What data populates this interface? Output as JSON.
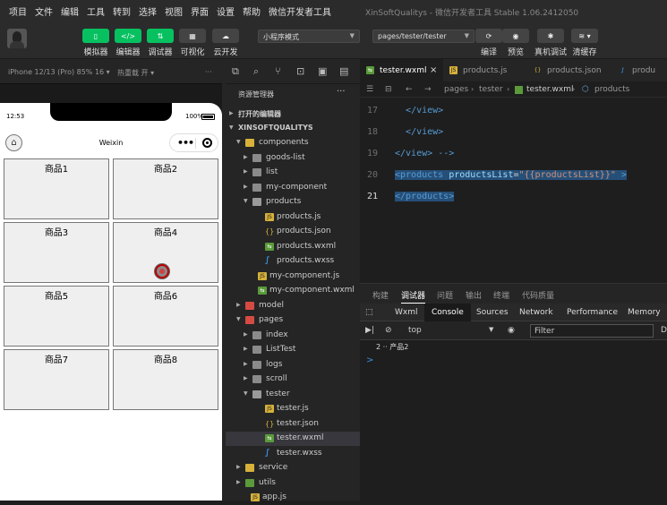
{
  "menubar": {
    "items": [
      "项目",
      "文件",
      "编辑",
      "工具",
      "转到",
      "选择",
      "视图",
      "界面",
      "设置",
      "帮助",
      "微信开发者工具"
    ],
    "title": "XinSoftQualitys - 微信开发者工具 Stable 1.06.2412050"
  },
  "toolbar": {
    "simulator": "模拟器",
    "editor": "编辑器",
    "debugger": "调试器",
    "visual": "可视化",
    "cloud": "云开发",
    "mode_select": "小程序模式",
    "page_select": "pages/tester/tester",
    "compile": "编译",
    "preview": "预览",
    "remote_debug": "真机调试",
    "clear_cache": "清缓存"
  },
  "simulator": {
    "device": "iPhone 12/13 (Pro) 85% 16 ▾",
    "hot_reload": "热重载 开 ▾",
    "more": "···",
    "time": "12:53",
    "battery": "100%",
    "nav_title": "Weixin",
    "capsule_dots": "•••",
    "products": [
      "商品1",
      "商品2",
      "商品3",
      "商品4",
      "商品5",
      "商品6",
      "商品7",
      "商品8"
    ]
  },
  "explorer": {
    "title": "资源管理器",
    "more": "···",
    "open_editors": "打开的编辑器",
    "project": "XINSOFTQUALITYS",
    "tree": [
      {
        "label": "components",
        "depth": 1,
        "type": "comp",
        "open": true
      },
      {
        "label": "goods-list",
        "depth": 2,
        "type": "folder",
        "open": false
      },
      {
        "label": "list",
        "depth": 2,
        "type": "folder",
        "open": false
      },
      {
        "label": "my-component",
        "depth": 2,
        "type": "folder",
        "open": false
      },
      {
        "label": "products",
        "depth": 2,
        "type": "open",
        "open": true
      },
      {
        "label": "products.js",
        "depth": 3,
        "type": "js"
      },
      {
        "label": "products.json",
        "depth": 3,
        "type": "json"
      },
      {
        "label": "products.wxml",
        "depth": 3,
        "type": "wxml"
      },
      {
        "label": "products.wxss",
        "depth": 3,
        "type": "wxss"
      },
      {
        "label": "my-component.js",
        "depth": 2,
        "type": "js"
      },
      {
        "label": "my-component.wxml",
        "depth": 2,
        "type": "wxml"
      },
      {
        "label": "model",
        "depth": 1,
        "type": "model",
        "open": false
      },
      {
        "label": "pages",
        "depth": 1,
        "type": "pages",
        "open": true
      },
      {
        "label": "index",
        "depth": 2,
        "type": "folder",
        "open": false
      },
      {
        "label": "ListTest",
        "depth": 2,
        "type": "folder",
        "open": false
      },
      {
        "label": "logs",
        "depth": 2,
        "type": "folder",
        "open": false
      },
      {
        "label": "scroll",
        "depth": 2,
        "type": "folder",
        "open": false
      },
      {
        "label": "tester",
        "depth": 2,
        "type": "open",
        "open": true
      },
      {
        "label": "tester.js",
        "depth": 3,
        "type": "js"
      },
      {
        "label": "tester.json",
        "depth": 3,
        "type": "json"
      },
      {
        "label": "tester.wxml",
        "depth": 3,
        "type": "wxml",
        "selected": true
      },
      {
        "label": "tester.wxss",
        "depth": 3,
        "type": "wxss"
      },
      {
        "label": "service",
        "depth": 1,
        "type": "serv",
        "open": false
      },
      {
        "label": "utils",
        "depth": 1,
        "type": "utils",
        "open": false
      },
      {
        "label": "app.js",
        "depth": 1,
        "type": "js"
      }
    ]
  },
  "editor": {
    "tabs": [
      {
        "label": "tester.wxml",
        "type": "wxml",
        "active": true
      },
      {
        "label": "products.js",
        "type": "js"
      },
      {
        "label": "products.json",
        "type": "json"
      },
      {
        "label": "produ",
        "type": "wxss"
      }
    ],
    "breadcrumb": [
      "pages",
      "tester",
      "tester.wxml",
      "products"
    ],
    "lines": [
      {
        "num": "17",
        "html": "<span class=\"tag\">&lt;/view&gt;</span>",
        "indent": "  "
      },
      {
        "num": "18",
        "html": "<span class=\"tag\">&lt;/view&gt;</span>",
        "indent": "  "
      },
      {
        "num": "19",
        "html": "<span class=\"tag\">&lt;/view&gt;</span> <span class=\"tag\">--&gt;</span>",
        "indent": ""
      },
      {
        "num": "20",
        "html": "<span class=\"hl\"><span class=\"tag\">&lt;products</span> <span class=\"attr\">productsList</span>=<span class=\"str\">\"{{productsList}}\"</span> <span class=\"tag\">&gt;</span></span>",
        "indent": ""
      },
      {
        "num": "21",
        "html": "<span class=\"hl\"><span class=\"tag\">&lt;/products&gt;</span></span>",
        "indent": "",
        "current": true
      }
    ]
  },
  "panel": {
    "tabs": [
      "构建",
      "调试器",
      "问题",
      "输出",
      "终端",
      "代码质量"
    ],
    "active_tab": "调试器",
    "devtools_tabs": [
      "Wxml",
      "Console",
      "Sources",
      "Network",
      "Performance",
      "Memory"
    ],
    "active_devtool": "Console",
    "context": "top",
    "filter_placeholder": "Filter",
    "more": "D",
    "log": "2 ·· 产品2",
    "prompt": ">"
  }
}
